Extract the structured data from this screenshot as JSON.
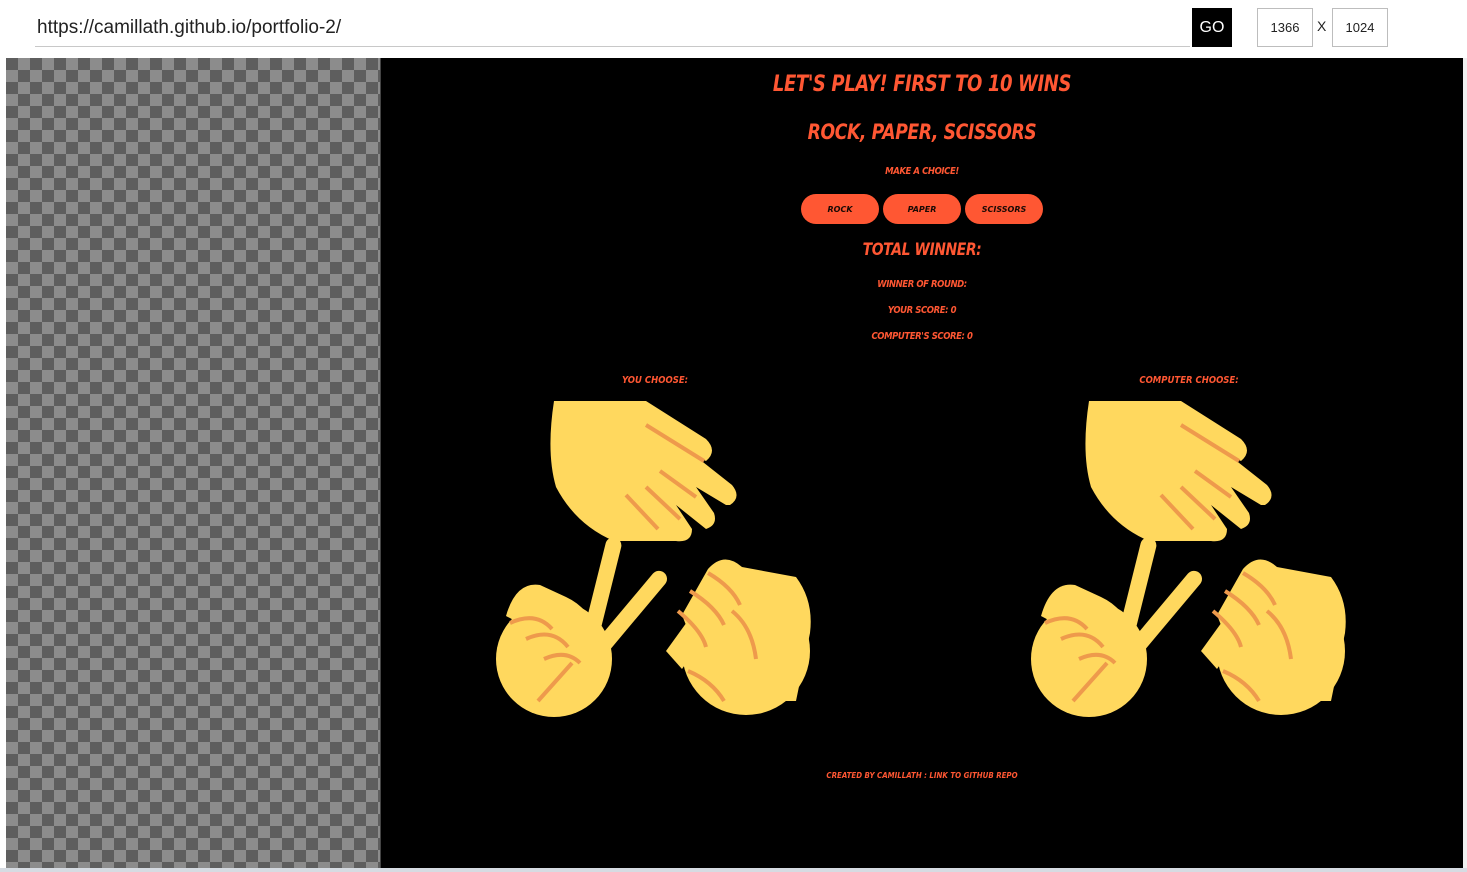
{
  "toolbar": {
    "url": "https://camillath.github.io/portfolio-2/",
    "go_label": "GO",
    "width_value": "1366",
    "separator": "X",
    "height_value": "1024"
  },
  "game": {
    "heading": "Let's play! First to 10 wins",
    "title": "Rock, Paper, Scissors",
    "prompt": "Make a choice!",
    "buttons": {
      "rock": "Rock",
      "paper": "Paper",
      "scissors": "Scissors"
    },
    "total_winner": "Total winner:",
    "winner_of_round": "Winner of round:",
    "your_score": "Your score: 0",
    "computer_score": "Computer's score: 0",
    "you_choose": "You choose:",
    "computer_choose": "Computer choose:",
    "footer": "Created by Camillath : Link to github repo"
  },
  "icons": {
    "hands_emoji_group": "rock-paper-scissors-hands-icon"
  },
  "colors": {
    "accent": "#ff5733",
    "background": "#000000",
    "hand_fill": "#ffd85e",
    "hand_line": "#ee9a4c",
    "go_button": "#000000"
  }
}
